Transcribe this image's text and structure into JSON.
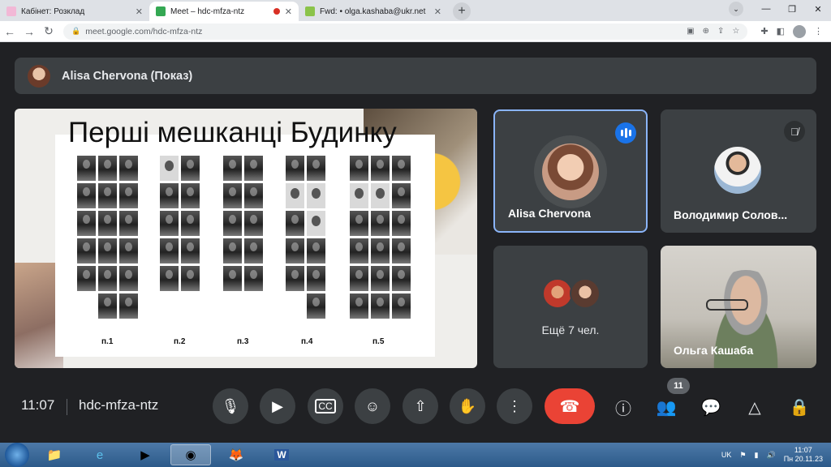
{
  "browser": {
    "tabs": [
      {
        "title": "Кабінет: Розклад",
        "fav_color": "#f2b8d6"
      },
      {
        "title": "Meet – hdc-mfza-ntz",
        "fav_color": "#34a853",
        "active": true
      },
      {
        "title": "Fwd: • olga.kashaba@ukr.net",
        "fav_color": "#8bc34a"
      }
    ],
    "url": "meet.google.com/hdc-mfza-ntz",
    "new_tab": "+",
    "window": {
      "dropdown": "⌄",
      "min": "—",
      "restore": "❐",
      "close": "✕"
    }
  },
  "meet": {
    "presenter_label": "Alisa Chervona (Показ)",
    "slide": {
      "title": "Перші мешканці Будинку",
      "labels": [
        "п.1",
        "п.2",
        "п.3",
        "п.4",
        "п.5"
      ]
    },
    "tiles": [
      {
        "name": "Alisa Chervona"
      },
      {
        "name": "Володимир Солов..."
      },
      {
        "more_label": "Ещё 7 чел."
      },
      {
        "name": "Ольга Кашаба"
      }
    ],
    "time": "11:07",
    "meeting_code": "hdc-mfza-ntz",
    "participants_count": "11",
    "accent_colors": {
      "hangup": "#ea4335",
      "speaking": "#1a73e8",
      "active_border": "#8ab4f8"
    }
  },
  "taskbar": {
    "lang": "UK",
    "time": "11:07",
    "date": "Пн 20.11.23"
  }
}
